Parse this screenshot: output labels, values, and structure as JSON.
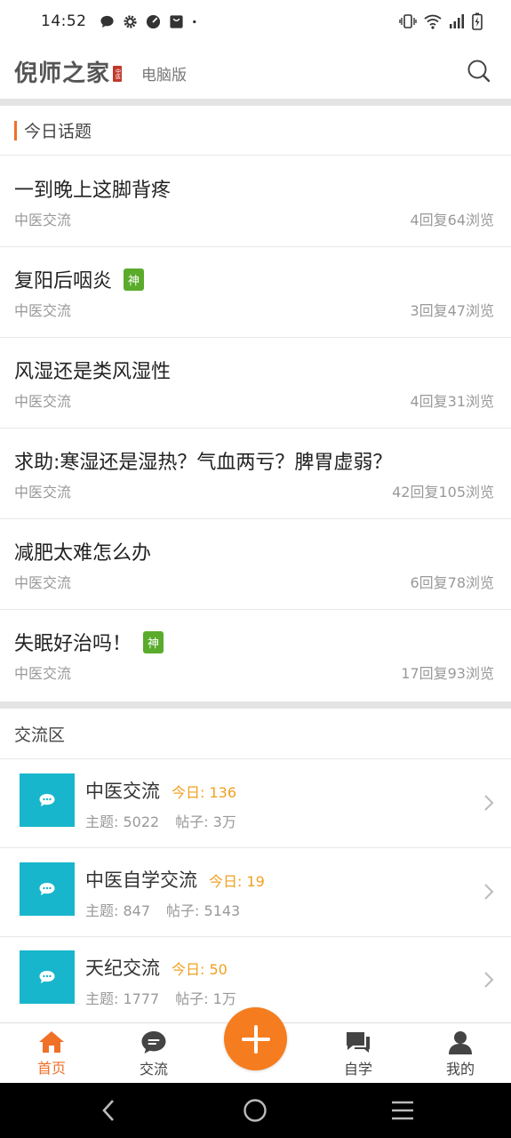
{
  "status_bar": {
    "time": "14:52",
    "icons_left": [
      "chat-bubble-icon",
      "gear-icon",
      "speedometer-icon",
      "shopping-bag-icon",
      "dot-icon"
    ],
    "icons_right": [
      "vibrate-icon",
      "wifi-icon",
      "signal-icon",
      "battery-charging-icon"
    ]
  },
  "header": {
    "logo": "倪师之家",
    "logo_seal": "中医",
    "desktop_link": "电脑版",
    "search_icon": "search-icon"
  },
  "today_topics": {
    "title": "今日话题",
    "items": [
      {
        "title": "一到晚上这脚背疼",
        "badge": "",
        "category": "中医交流",
        "stats": "4回复64浏览"
      },
      {
        "title": "复阳后咽炎",
        "badge": "神",
        "category": "中医交流",
        "stats": "3回复47浏览"
      },
      {
        "title": "风湿还是类风湿性",
        "badge": "",
        "category": "中医交流",
        "stats": "4回复31浏览"
      },
      {
        "title": "求助:寒湿还是湿热？气血两亏？脾胃虚弱？",
        "badge": "",
        "category": "中医交流",
        "stats": "42回复105浏览"
      },
      {
        "title": "减肥太难怎么办",
        "badge": "",
        "category": "中医交流",
        "stats": "6回复78浏览"
      },
      {
        "title": "失眠好治吗！",
        "badge": "神",
        "category": "中医交流",
        "stats": "17回复93浏览"
      }
    ]
  },
  "forums": {
    "title": "交流区",
    "items": [
      {
        "name": "中医交流",
        "today": "今日: 136",
        "topics": "主题: 5022",
        "posts": "帖子: 3万"
      },
      {
        "name": "中医自学交流",
        "today": "今日: 19",
        "topics": "主题: 847",
        "posts": "帖子: 5143"
      },
      {
        "name": "天纪交流",
        "today": "今日: 50",
        "topics": "主题: 1777",
        "posts": "帖子: 1万"
      }
    ]
  },
  "bottom_nav": {
    "items": [
      {
        "label": "首页",
        "icon": "home-icon",
        "active": true
      },
      {
        "label": "交流",
        "icon": "chat-icon",
        "active": false
      },
      {
        "label": "自学",
        "icon": "messages-icon",
        "active": false
      },
      {
        "label": "我的",
        "icon": "user-icon",
        "active": false
      }
    ],
    "fab_icon": "plus-icon"
  },
  "colors": {
    "accent": "#f07028",
    "badge_green": "#5aab2c",
    "forum_icon_bg": "#18b6cc",
    "today_orange": "#f0a020"
  }
}
